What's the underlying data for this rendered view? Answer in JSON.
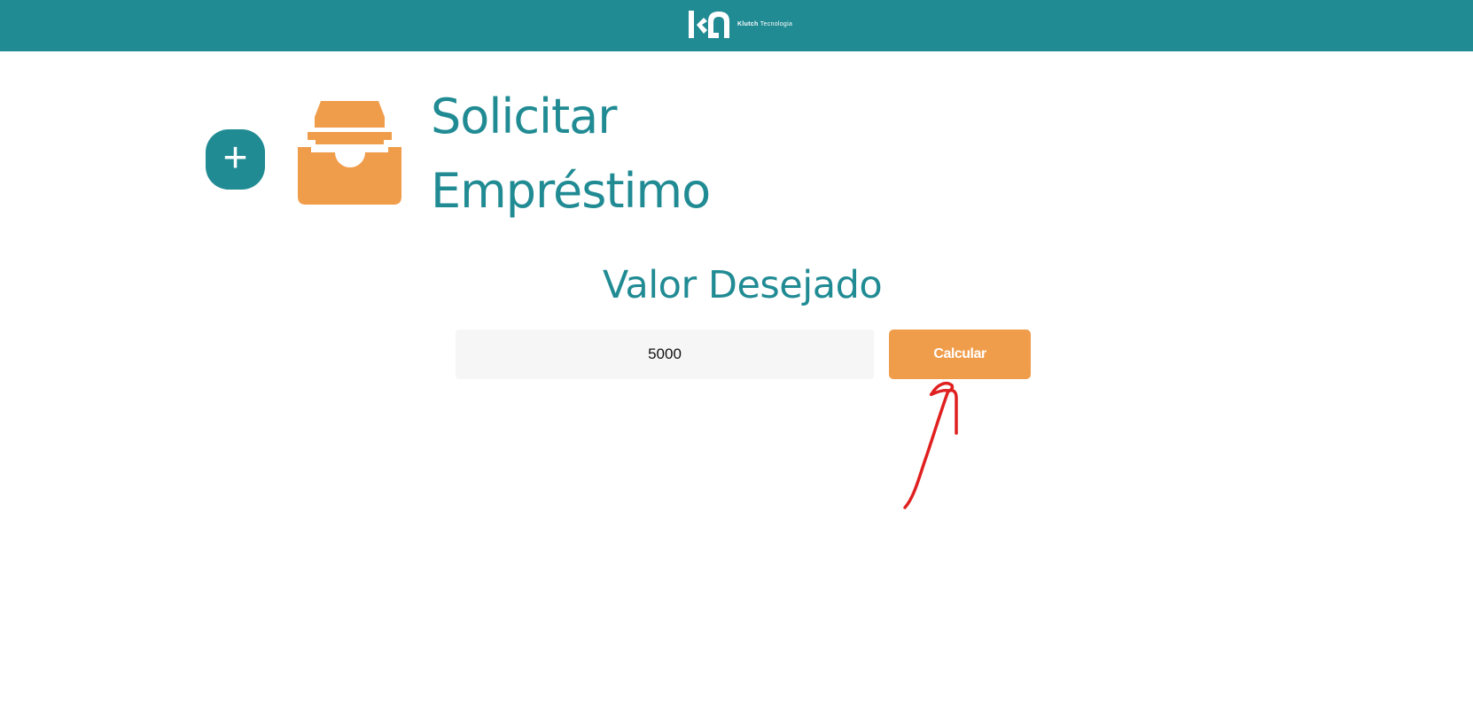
{
  "header": {
    "brand_name": "Klutch",
    "brand_suffix": "Tecnologia",
    "logo_icon": "kn-logo-icon",
    "background_color": "#218b94"
  },
  "actions": {
    "add_icon": "plus-icon",
    "add_symbol": "+"
  },
  "page": {
    "icon": "inbox-icon",
    "title_line1": "Solicitar",
    "title_line2": "Empréstimo"
  },
  "form": {
    "label": "Valor Desejado",
    "amount_value": "5000",
    "calculate_label": "Calcular"
  },
  "annotation": {
    "icon": "hand-drawn-arrow",
    "color": "#e02020"
  },
  "colors": {
    "primary": "#218b94",
    "accent": "#f09d4b",
    "input_background": "#f6f6f6"
  }
}
